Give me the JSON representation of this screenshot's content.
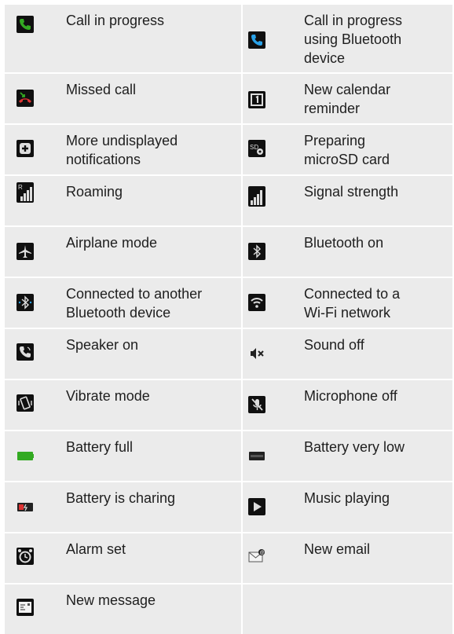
{
  "rows": [
    {
      "left": {
        "label": "Call in progress",
        "icon": "call-icon"
      },
      "right": {
        "label": "Call in progress\nusing Bluetooth\ndevice",
        "icon": "bluetooth-call-icon"
      }
    },
    {
      "left": {
        "label": "Missed call",
        "icon": "missed-call-icon"
      },
      "right": {
        "label": "New calendar\nreminder",
        "icon": "calendar-icon"
      }
    },
    {
      "left": {
        "label": "More undisplayed\nnotifications",
        "icon": "more-notifications-icon"
      },
      "right": {
        "label": "Preparing\nmicroSD card",
        "icon": "sd-card-icon"
      }
    },
    {
      "left": {
        "label": "Roaming",
        "icon": "roaming-icon"
      },
      "right": {
        "label": "Signal strength",
        "icon": "signal-icon"
      }
    },
    {
      "left": {
        "label": "Airplane mode",
        "icon": "airplane-icon"
      },
      "right": {
        "label": "Bluetooth on",
        "icon": "bluetooth-icon"
      }
    },
    {
      "left": {
        "label": "Connected to another\nBluetooth device",
        "icon": "bluetooth-connected-icon"
      },
      "right": {
        "label": "Connected to a\nWi-Fi network",
        "icon": "wifi-icon"
      }
    },
    {
      "left": {
        "label": "Speaker on",
        "icon": "speaker-icon"
      },
      "right": {
        "label": "Sound off",
        "icon": "sound-off-icon"
      }
    },
    {
      "left": {
        "label": "Vibrate mode",
        "icon": "vibrate-icon"
      },
      "right": {
        "label": "Microphone off",
        "icon": "mic-off-icon"
      }
    },
    {
      "left": {
        "label": "Battery full",
        "icon": "battery-full-icon"
      },
      "right": {
        "label": "Battery very low",
        "icon": "battery-low-icon"
      }
    },
    {
      "left": {
        "label": "Battery is charing",
        "icon": "battery-charging-icon"
      },
      "right": {
        "label": "Music playing",
        "icon": "play-icon"
      }
    },
    {
      "left": {
        "label": "Alarm set",
        "icon": "alarm-icon"
      },
      "right": {
        "label": "New email",
        "icon": "email-icon"
      }
    },
    {
      "left": {
        "label": "New message",
        "icon": "message-icon"
      },
      "right": {
        "label": "",
        "icon": ""
      }
    }
  ],
  "colors": {
    "cell_bg": "#ebebeb",
    "icon_bg": "#101010",
    "green": "#33aa22",
    "blue": "#2aa2e8",
    "red": "#dd3333"
  }
}
